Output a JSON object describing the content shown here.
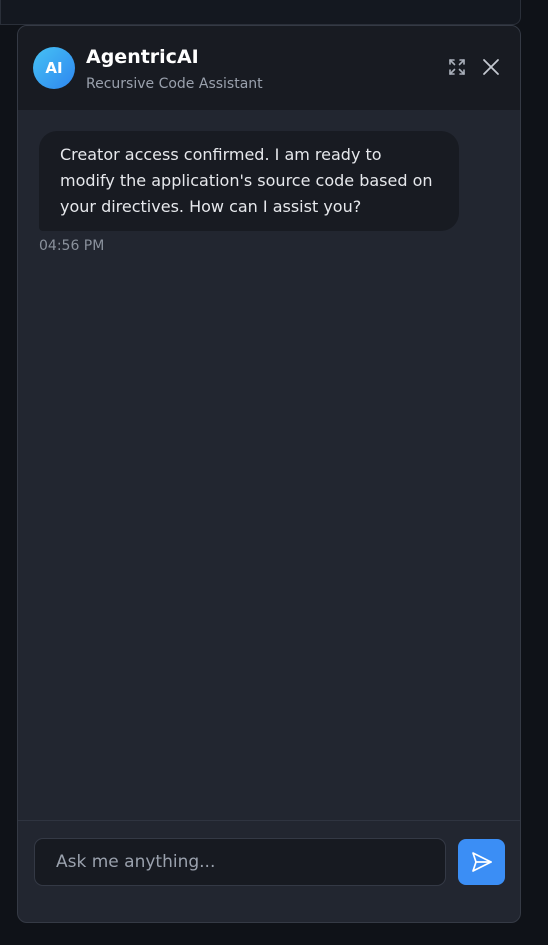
{
  "header": {
    "avatar_text": "AI",
    "title": "AgentricAI",
    "subtitle": "Recursive Code Assistant",
    "expand_icon": "expand-icon",
    "close_icon": "close-icon"
  },
  "messages": [
    {
      "sender": "assistant",
      "text": "Creator access confirmed. I am ready to modify the application's source code based on your directives. How can I assist you?",
      "time": "04:56 PM"
    }
  ],
  "composer": {
    "placeholder": "Ask me anything...",
    "value": "",
    "send_icon": "send-icon"
  },
  "colors": {
    "accent": "#3b8ef5",
    "avatar_gradient_start": "#46c2f4",
    "avatar_gradient_end": "#2e86f0",
    "panel_bg": "#222630",
    "header_bg": "#181b22",
    "bubble_bg": "#181b22"
  }
}
